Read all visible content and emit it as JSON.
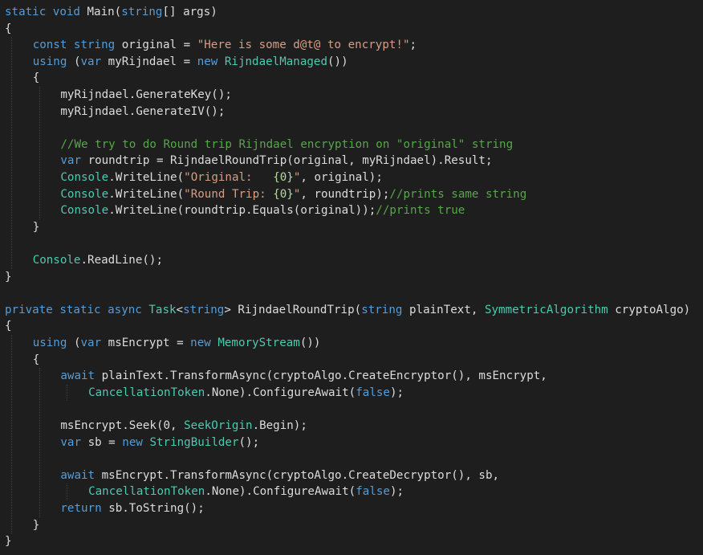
{
  "editor": {
    "colors": {
      "background": "#1e1e1e",
      "plain": "#dcdcdc",
      "keyword": "#569cd6",
      "type": "#4ec9b0",
      "string": "#d69d85",
      "comment": "#57a64a",
      "format_placeholder": "#b8d7a3",
      "indent_guide": "#3f3f3f"
    },
    "lines": [
      {
        "indent": 0,
        "tokens": [
          {
            "t": "static void ",
            "c": "kw"
          },
          {
            "t": "Main(",
            "c": "pl"
          },
          {
            "t": "string",
            "c": "kw"
          },
          {
            "t": "[] args)",
            "c": "pl"
          }
        ]
      },
      {
        "indent": 0,
        "tokens": [
          {
            "t": "{",
            "c": "pl"
          }
        ]
      },
      {
        "indent": 1,
        "tokens": [
          {
            "t": "const string ",
            "c": "kw"
          },
          {
            "t": "original = ",
            "c": "pl"
          },
          {
            "t": "\"Here is some d@t@ to encrypt!\"",
            "c": "st"
          },
          {
            "t": ";",
            "c": "pl"
          }
        ]
      },
      {
        "indent": 1,
        "tokens": [
          {
            "t": "using ",
            "c": "kw"
          },
          {
            "t": "(",
            "c": "pl"
          },
          {
            "t": "var ",
            "c": "kw"
          },
          {
            "t": "myRijndael = ",
            "c": "pl"
          },
          {
            "t": "new ",
            "c": "kw"
          },
          {
            "t": "RijndaelManaged",
            "c": "ty"
          },
          {
            "t": "())",
            "c": "pl"
          }
        ]
      },
      {
        "indent": 1,
        "tokens": [
          {
            "t": "{",
            "c": "pl"
          }
        ]
      },
      {
        "indent": 2,
        "tokens": [
          {
            "t": "myRijndael.GenerateKey();",
            "c": "pl"
          }
        ]
      },
      {
        "indent": 2,
        "tokens": [
          {
            "t": "myRijndael.GenerateIV();",
            "c": "pl"
          }
        ]
      },
      {
        "indent": 0,
        "tokens": []
      },
      {
        "indent": 2,
        "tokens": [
          {
            "t": "//We try to do Round trip Rijndael encryption on \"original\" string",
            "c": "cm"
          }
        ]
      },
      {
        "indent": 2,
        "tokens": [
          {
            "t": "var ",
            "c": "kw"
          },
          {
            "t": "roundtrip = RijndaelRoundTrip(original, myRijndael).Result;",
            "c": "pl"
          }
        ]
      },
      {
        "indent": 2,
        "tokens": [
          {
            "t": "Console",
            "c": "ty"
          },
          {
            "t": ".WriteLine(",
            "c": "pl"
          },
          {
            "t": "\"Original:   ",
            "c": "st"
          },
          {
            "t": "{0}",
            "c": "fmt"
          },
          {
            "t": "\"",
            "c": "st"
          },
          {
            "t": ", original);",
            "c": "pl"
          }
        ]
      },
      {
        "indent": 2,
        "tokens": [
          {
            "t": "Console",
            "c": "ty"
          },
          {
            "t": ".WriteLine(",
            "c": "pl"
          },
          {
            "t": "\"Round Trip: ",
            "c": "st"
          },
          {
            "t": "{0}",
            "c": "fmt"
          },
          {
            "t": "\"",
            "c": "st"
          },
          {
            "t": ", roundtrip);",
            "c": "pl"
          },
          {
            "t": "//prints same string",
            "c": "cm"
          }
        ]
      },
      {
        "indent": 2,
        "tokens": [
          {
            "t": "Console",
            "c": "ty"
          },
          {
            "t": ".WriteLine(roundtrip.Equals(original));",
            "c": "pl"
          },
          {
            "t": "//prints true",
            "c": "cm"
          }
        ]
      },
      {
        "indent": 1,
        "tokens": [
          {
            "t": "}",
            "c": "pl"
          }
        ]
      },
      {
        "indent": 0,
        "tokens": []
      },
      {
        "indent": 1,
        "tokens": [
          {
            "t": "Console",
            "c": "ty"
          },
          {
            "t": ".ReadLine();",
            "c": "pl"
          }
        ]
      },
      {
        "indent": 0,
        "tokens": [
          {
            "t": "}",
            "c": "pl"
          }
        ]
      },
      {
        "indent": 0,
        "tokens": []
      },
      {
        "indent": 0,
        "tokens": [
          {
            "t": "private static async ",
            "c": "kw"
          },
          {
            "t": "Task",
            "c": "ty"
          },
          {
            "t": "<",
            "c": "pl"
          },
          {
            "t": "string",
            "c": "kw"
          },
          {
            "t": "> RijndaelRoundTrip(",
            "c": "pl"
          },
          {
            "t": "string ",
            "c": "kw"
          },
          {
            "t": "plainText, ",
            "c": "pl"
          },
          {
            "t": "SymmetricAlgorithm ",
            "c": "ty"
          },
          {
            "t": "cryptoAlgo)",
            "c": "pl"
          }
        ]
      },
      {
        "indent": 0,
        "tokens": [
          {
            "t": "{",
            "c": "pl"
          }
        ]
      },
      {
        "indent": 1,
        "tokens": [
          {
            "t": "using ",
            "c": "kw"
          },
          {
            "t": "(",
            "c": "pl"
          },
          {
            "t": "var ",
            "c": "kw"
          },
          {
            "t": "msEncrypt = ",
            "c": "pl"
          },
          {
            "t": "new ",
            "c": "kw"
          },
          {
            "t": "MemoryStream",
            "c": "ty"
          },
          {
            "t": "())",
            "c": "pl"
          }
        ]
      },
      {
        "indent": 1,
        "tokens": [
          {
            "t": "{",
            "c": "pl"
          }
        ]
      },
      {
        "indent": 2,
        "tokens": [
          {
            "t": "await ",
            "c": "kw"
          },
          {
            "t": "plainText.TransformAsync(cryptoAlgo.CreateEncryptor(), msEncrypt,",
            "c": "pl"
          }
        ]
      },
      {
        "indent": 3,
        "tokens": [
          {
            "t": "CancellationToken",
            "c": "ty"
          },
          {
            "t": ".None).ConfigureAwait(",
            "c": "pl"
          },
          {
            "t": "false",
            "c": "kw"
          },
          {
            "t": ");",
            "c": "pl"
          }
        ]
      },
      {
        "indent": 0,
        "tokens": []
      },
      {
        "indent": 2,
        "tokens": [
          {
            "t": "msEncrypt.Seek(0, ",
            "c": "pl"
          },
          {
            "t": "SeekOrigin",
            "c": "ty"
          },
          {
            "t": ".Begin);",
            "c": "pl"
          }
        ]
      },
      {
        "indent": 2,
        "tokens": [
          {
            "t": "var ",
            "c": "kw"
          },
          {
            "t": "sb = ",
            "c": "pl"
          },
          {
            "t": "new ",
            "c": "kw"
          },
          {
            "t": "StringBuilder",
            "c": "ty"
          },
          {
            "t": "();",
            "c": "pl"
          }
        ]
      },
      {
        "indent": 0,
        "tokens": []
      },
      {
        "indent": 2,
        "tokens": [
          {
            "t": "await ",
            "c": "kw"
          },
          {
            "t": "msEncrypt.TransformAsync(cryptoAlgo.CreateDecryptor(), sb,",
            "c": "pl"
          }
        ]
      },
      {
        "indent": 3,
        "tokens": [
          {
            "t": "CancellationToken",
            "c": "ty"
          },
          {
            "t": ".None).ConfigureAwait(",
            "c": "pl"
          },
          {
            "t": "false",
            "c": "kw"
          },
          {
            "t": ");",
            "c": "pl"
          }
        ]
      },
      {
        "indent": 2,
        "tokens": [
          {
            "t": "return ",
            "c": "kw"
          },
          {
            "t": "sb.ToString();",
            "c": "pl"
          }
        ]
      },
      {
        "indent": 1,
        "tokens": [
          {
            "t": "}",
            "c": "pl"
          }
        ]
      },
      {
        "indent": 0,
        "tokens": [
          {
            "t": "}",
            "c": "pl"
          }
        ]
      }
    ],
    "indent_guides": [
      {
        "level": 0,
        "from_line": 2,
        "to_line": 15
      },
      {
        "level": 1,
        "from_line": 5,
        "to_line": 12
      },
      {
        "level": 0,
        "from_line": 20,
        "to_line": 31
      },
      {
        "level": 1,
        "from_line": 22,
        "to_line": 30
      },
      {
        "level": 2,
        "from_line": 23,
        "to_line": 23
      },
      {
        "level": 2,
        "from_line": 29,
        "to_line": 29
      }
    ]
  }
}
